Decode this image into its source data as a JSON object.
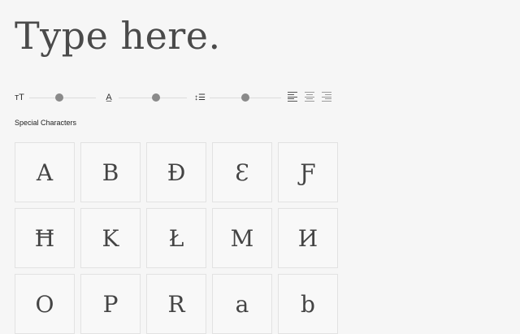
{
  "preview": {
    "text": "Type here."
  },
  "controls": {
    "size_icon": "ᴛT",
    "tracking_icon": "A̲",
    "leading_icon": "↕☰",
    "size_level": 0.45,
    "tracking_level": 0.55,
    "leading_level": 0.5,
    "alignment": [
      "left",
      "center",
      "right"
    ],
    "selected_alignment": "left"
  },
  "special_characters": {
    "title": "Special Characters",
    "glyphs": [
      "A",
      "B",
      "Ð",
      "Ɛ",
      "Ƒ",
      "Ħ",
      "K",
      "Ł",
      "M",
      "И",
      "O",
      "P",
      "R",
      "a",
      "b"
    ]
  }
}
